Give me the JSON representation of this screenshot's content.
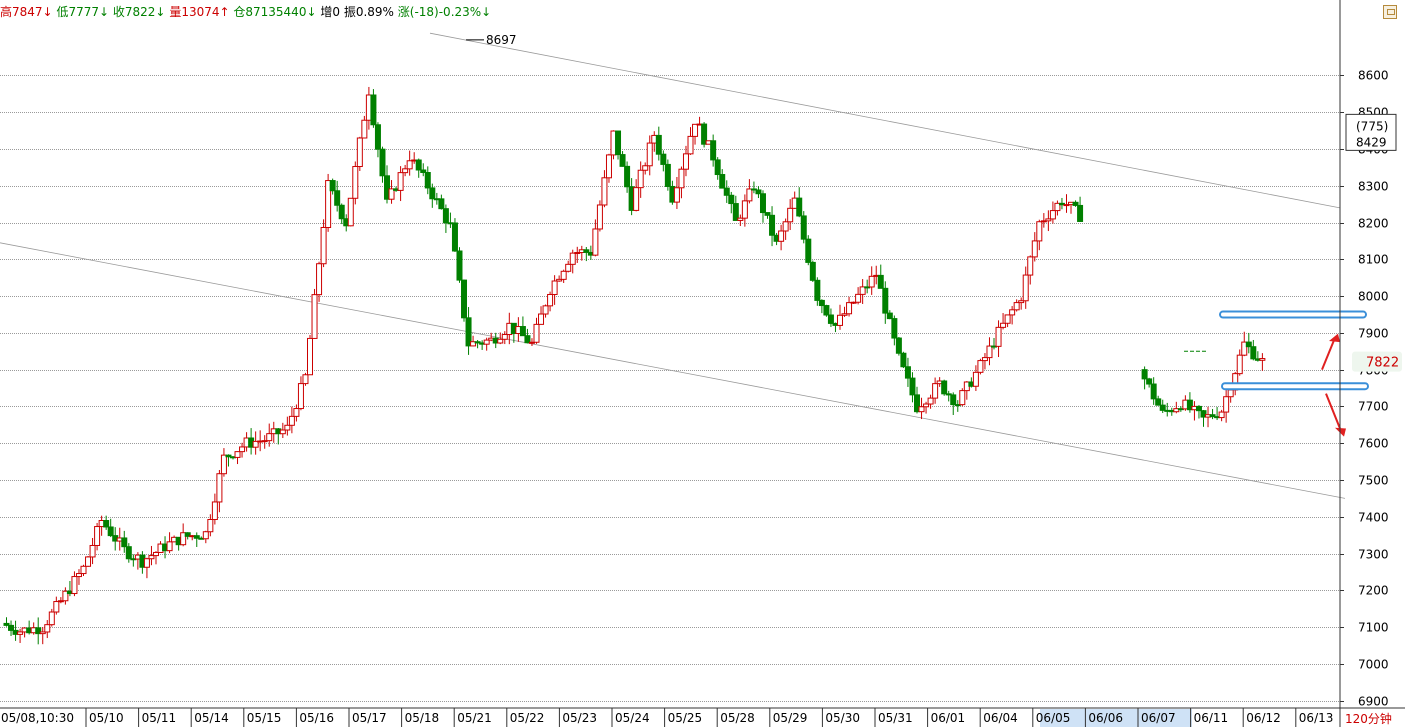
{
  "header": {
    "high": "高7847↓",
    "low": "低7777↓",
    "close": "收7822↓",
    "volume": "量13074↑",
    "open_interest": "仓87135440↓",
    "increase": "增0",
    "amplitude": "振0.89%",
    "change": "涨(-18)-0.23%↓"
  },
  "axis_box": {
    "count": "(775)",
    "value": "8429"
  },
  "price_label": "7822",
  "timeframe": "120分钟",
  "peak_label": "8697",
  "colors": {
    "up": "#cc0000",
    "down": "#008000",
    "band": "#3a8fd9",
    "arrow": "#e02020"
  },
  "chart_data": {
    "type": "candlestick",
    "ylim": [
      6880,
      8740
    ],
    "y_ticks": [
      6900,
      7000,
      7100,
      7200,
      7300,
      7400,
      7500,
      7600,
      7700,
      7800,
      7900,
      8000,
      8100,
      8200,
      8300,
      8400,
      8500,
      8600
    ],
    "x_labels": [
      "05/08,10:30",
      "05/10",
      "05/11",
      "05/14",
      "05/15",
      "05/16",
      "05/17",
      "05/18",
      "05/21",
      "05/22",
      "05/23",
      "05/24",
      "05/25",
      "05/28",
      "05/29",
      "05/30",
      "05/31",
      "06/01",
      "06/04",
      "06/05",
      "06/06",
      "06/07",
      "06/11",
      "06/12",
      "06/13"
    ],
    "last_price": 7822,
    "peak": 8697,
    "support_band": 7755,
    "resistance_band": 7950,
    "anchors": [
      7110,
      7090,
      7100,
      7170,
      7260,
      7390,
      7310,
      7280,
      7320,
      7345,
      7355,
      7560,
      7600,
      7610,
      7640,
      7780,
      8300,
      8200,
      8560,
      8250,
      8380,
      8300,
      8190,
      7870,
      7880,
      7920,
      7870,
      8020,
      8120,
      8120,
      8440,
      8250,
      8440,
      8270,
      8480,
      8380,
      8200,
      8300,
      8140,
      8260,
      8000,
      7920,
      8000,
      8060,
      7830,
      7700,
      7760,
      7710,
      7810,
      7900,
      8000,
      8200,
      8260,
      8220,
      null,
      7800,
      7680,
      7710,
      7665,
      7690,
      7870,
      7822
    ]
  }
}
